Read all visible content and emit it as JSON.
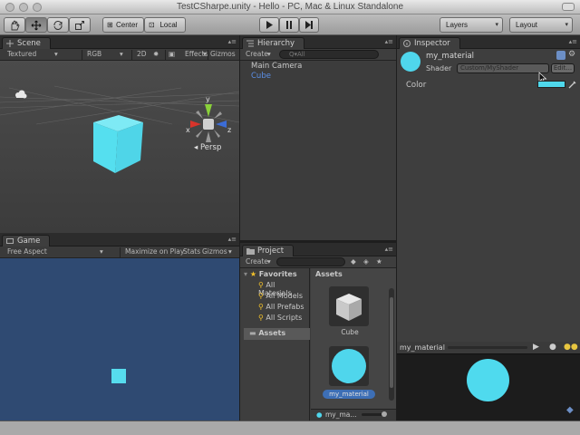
{
  "window": {
    "title": "TestCSharpe.unity - Hello - PC, Mac & Linux Standalone"
  },
  "toolbar": {
    "pivot_center": "Center",
    "pivot_local": "Local",
    "layers": "Layers",
    "layout": "Layout"
  },
  "scene": {
    "tab": "Scene",
    "shading": "Textured",
    "render": "RGB",
    "mode2d": "2D",
    "effects": "Effects",
    "gizmos": "Gizmos",
    "persp": "Persp",
    "axis_x": "x",
    "axis_y": "y",
    "axis_z": "z",
    "cube_color": "#5ce0f0"
  },
  "game": {
    "tab": "Game",
    "aspect": "Free Aspect",
    "maximize": "Maximize on Play",
    "stats": "Stats",
    "gizmos": "Gizmos",
    "background": "#2f4a72"
  },
  "hierarchy": {
    "tab": "Hierarchy",
    "create": "Create",
    "search_placeholder": "Q▾All",
    "items": [
      "Main Camera",
      "Cube"
    ]
  },
  "project": {
    "tab": "Project",
    "create": "Create",
    "favorites": "Favorites",
    "fav_items": [
      "All Materials",
      "All Models",
      "All Prefabs",
      "All Scripts"
    ],
    "assets": "Assets",
    "assets_header": "Assets",
    "asset_items": [
      "Cube",
      "my_material"
    ],
    "footer_item": "my_ma..."
  },
  "inspector": {
    "tab": "Inspector",
    "material_name": "my_material",
    "shader_label": "Shader",
    "shader_value": "Custom/MyShader",
    "edit_button": "Edit...",
    "color_label": "Color",
    "color_value": "#4fd8ec",
    "preview_name": "my_material"
  },
  "colors": {
    "accent": "#5ce0f0",
    "selection": "#3d6fb6"
  }
}
